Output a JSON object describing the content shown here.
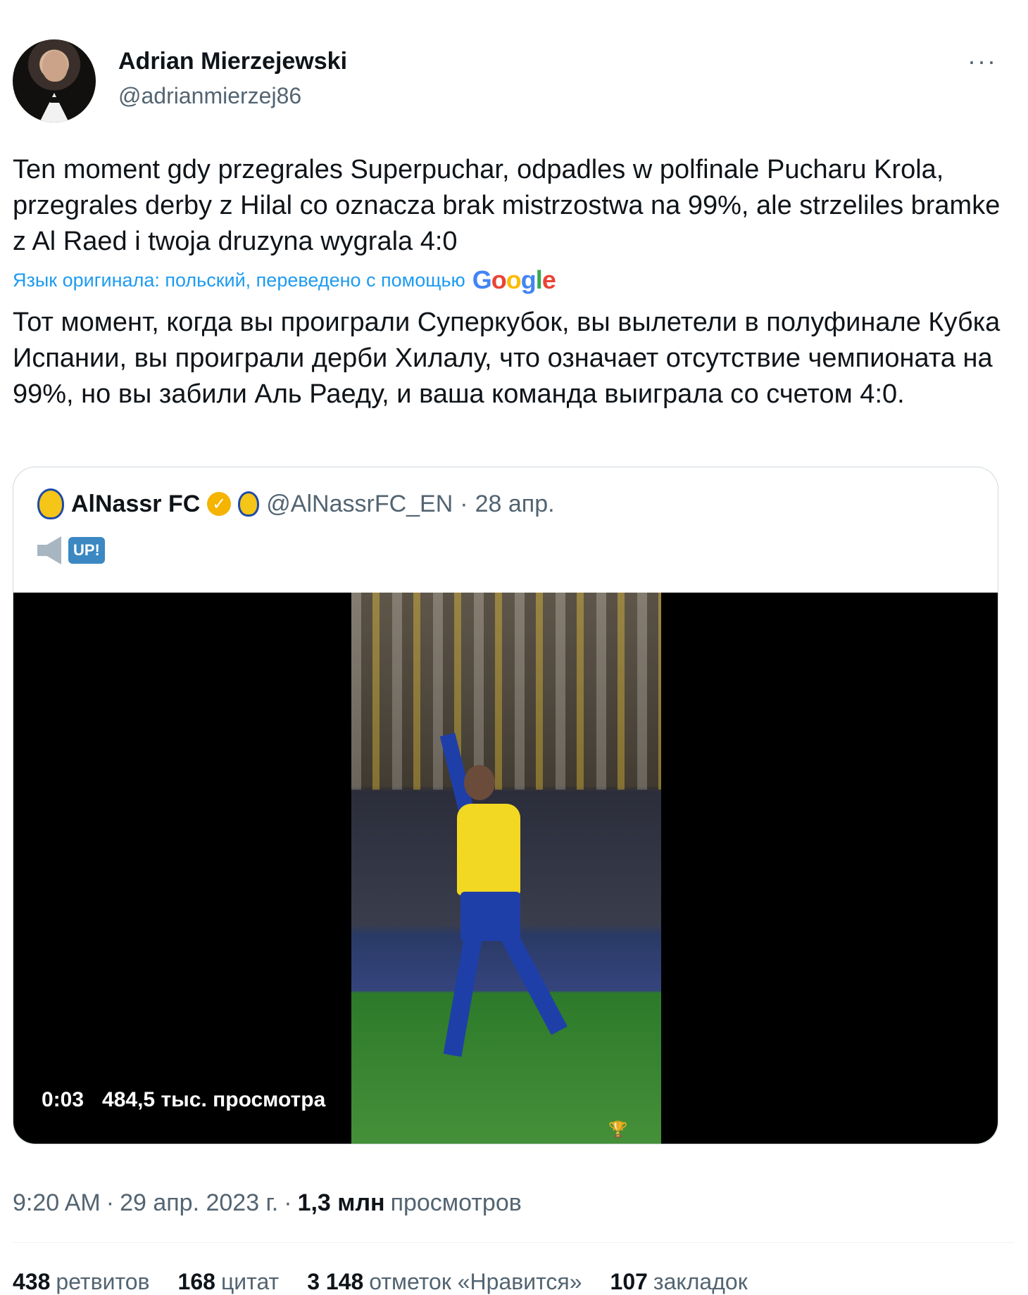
{
  "author": {
    "name": "Adrian Mierzejewski",
    "handle": "@adrianmierzej86"
  },
  "more_label": "···",
  "tweet": {
    "original_text": "Ten moment gdy przegrales Superpuchar, odpadles w polfinale Pucharu Krola, przegrales derby z Hilal co oznacza brak mistrzostwa na 99%,  ale strzeliles bramke z Al Raed i twoja druzyna wygrala 4:0",
    "translation_note": "Язык оригинала: польский, переведено с помощью",
    "translation_provider": "Google",
    "translated_text": "Тот момент, когда вы проиграли Суперкубок, вы вылетели в полуфинале Кубка Испании, вы проиграли дерби Хилалу, что означает отсутствие чемпионата на 99%, но вы забили Аль Раеду, и ваша команда выиграла со счетом 4:0."
  },
  "quoted": {
    "name": "AlNassr FC",
    "handle": "@AlNassrFC_EN",
    "separator": "·",
    "date": "28 апр.",
    "emoji_badge": "UP!",
    "video": {
      "duration": "0:03",
      "views": "484,5 тыс. просмотра",
      "watermark": "🏆"
    }
  },
  "meta": {
    "time": "9:20 AM",
    "separator": "·",
    "date": "29 апр. 2023 г.",
    "separator2": "·",
    "views_count": "1,3 млн",
    "views_label": "просмотров"
  },
  "stats": [
    {
      "count": "438",
      "label": "ретвитов"
    },
    {
      "count": "168",
      "label": "цитат"
    },
    {
      "count": "3 148",
      "label": "отметок «Нравится»"
    },
    {
      "count": "107",
      "label": "закладок"
    }
  ],
  "colors": {
    "link": "#1d9bf0",
    "secondary_text": "#536471",
    "primary_text": "#0f1419",
    "border": "#cfd9de"
  }
}
